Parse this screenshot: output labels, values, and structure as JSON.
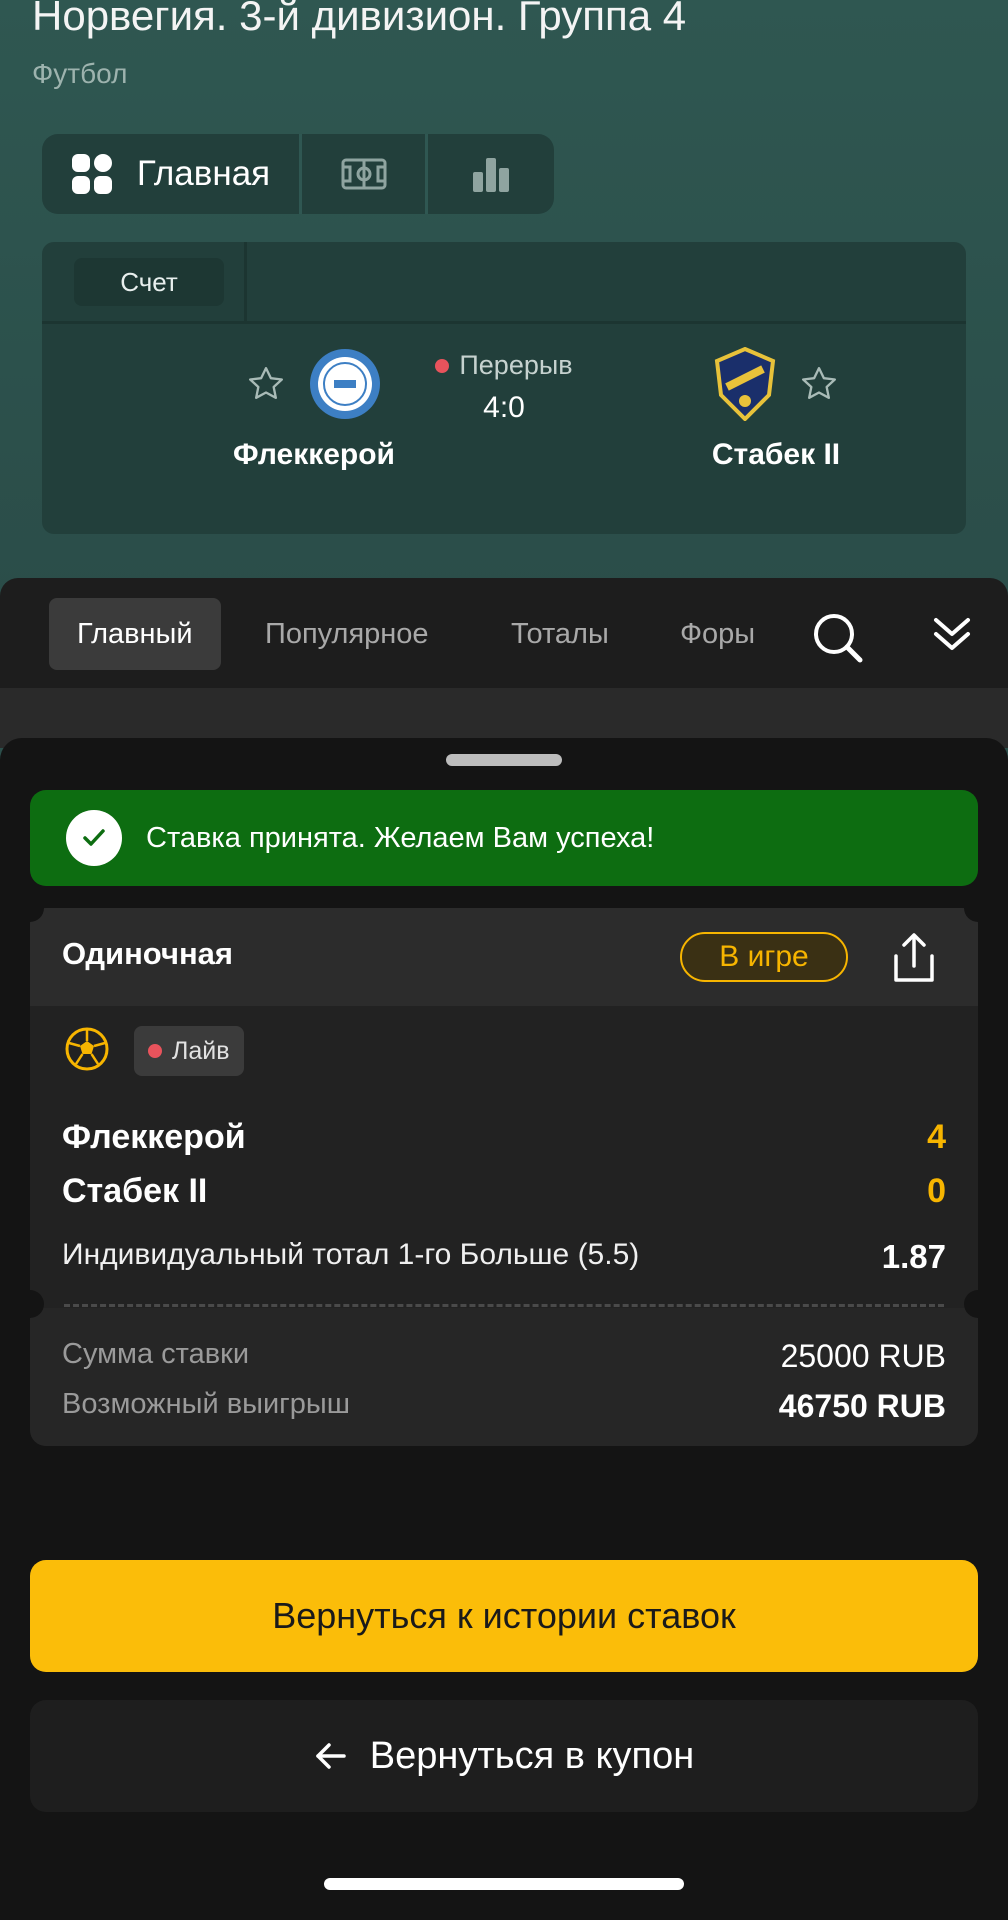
{
  "header": {
    "league_title": "Норвегия. 3-й дивизион. Группа 4",
    "sport": "Футбол",
    "view_tabs": {
      "main_label": "Главная"
    }
  },
  "match": {
    "score_tab": "Счет",
    "status": "Перерыв",
    "score": "4:0",
    "home_team": "Флеккерой",
    "away_team": "Стабек II"
  },
  "market_tabs": [
    "Главный",
    "Популярное",
    "Тоталы",
    "Форы"
  ],
  "sheet": {
    "success_message": "Ставка принята. Желаем Вам успеха!",
    "bet": {
      "type": "Одиночная",
      "status": "В игре",
      "live_label": "Лайв",
      "home_team": "Флеккерой",
      "home_score": "4",
      "away_team": "Стабек II",
      "away_score": "0",
      "market": "Индивидуальный тотал 1-го Больше (5.5)",
      "odds": "1.87",
      "stake_label": "Сумма ставки",
      "stake_value": "25000 RUB",
      "win_label": "Возможный выигрыш",
      "win_value": "46750 RUB"
    },
    "primary_button": "Вернуться к истории ставок",
    "secondary_button": "Вернуться в купон"
  },
  "colors": {
    "accent": "#fbbd09",
    "success": "#0d6d11",
    "header_bg": "#2c4f4b",
    "live_dot": "#e8535c"
  },
  "icons": [
    "grid-icon",
    "field-icon",
    "stats-icon",
    "star-icon",
    "search-icon",
    "collapse-icon",
    "check-icon",
    "share-icon",
    "football-icon",
    "arrow-left-icon"
  ]
}
